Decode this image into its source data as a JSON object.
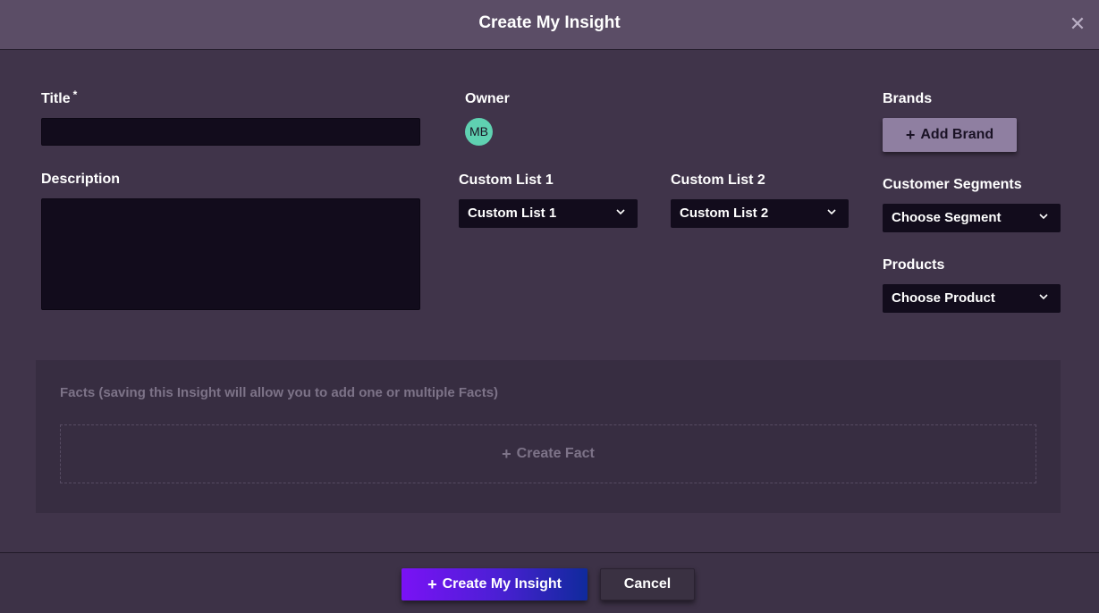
{
  "modal": {
    "title": "Create My Insight",
    "close_symbol": "✕"
  },
  "form": {
    "title_label": "Title",
    "required_marker": "*",
    "title_value": "",
    "description_label": "Description",
    "description_value": "",
    "owner_label": "Owner",
    "owner_initials": "MB",
    "custom_list_1": {
      "label": "Custom List 1",
      "value": "Custom List 1"
    },
    "custom_list_2": {
      "label": "Custom List 2",
      "value": "Custom List 2"
    },
    "brands_label": "Brands",
    "add_brand_label": "Add Brand",
    "segments": {
      "label": "Customer Segments",
      "value": "Choose Segment"
    },
    "products": {
      "label": "Products",
      "value": "Choose Product"
    }
  },
  "facts": {
    "description": "Facts (saving this Insight will allow you to add one or multiple Facts)",
    "create_label": "Create Fact"
  },
  "footer": {
    "create_label": "Create My Insight",
    "cancel_label": "Cancel"
  },
  "icons": {
    "plus": "+"
  },
  "colors": {
    "background": "#40344a",
    "header": "#5b4d66",
    "input": "#120c1c",
    "avatar": "#5fd1b1",
    "add_brand": "#8f7fa1",
    "primary_gradient_start": "#7a12f5",
    "primary_gradient_end": "#0f2a9c"
  }
}
